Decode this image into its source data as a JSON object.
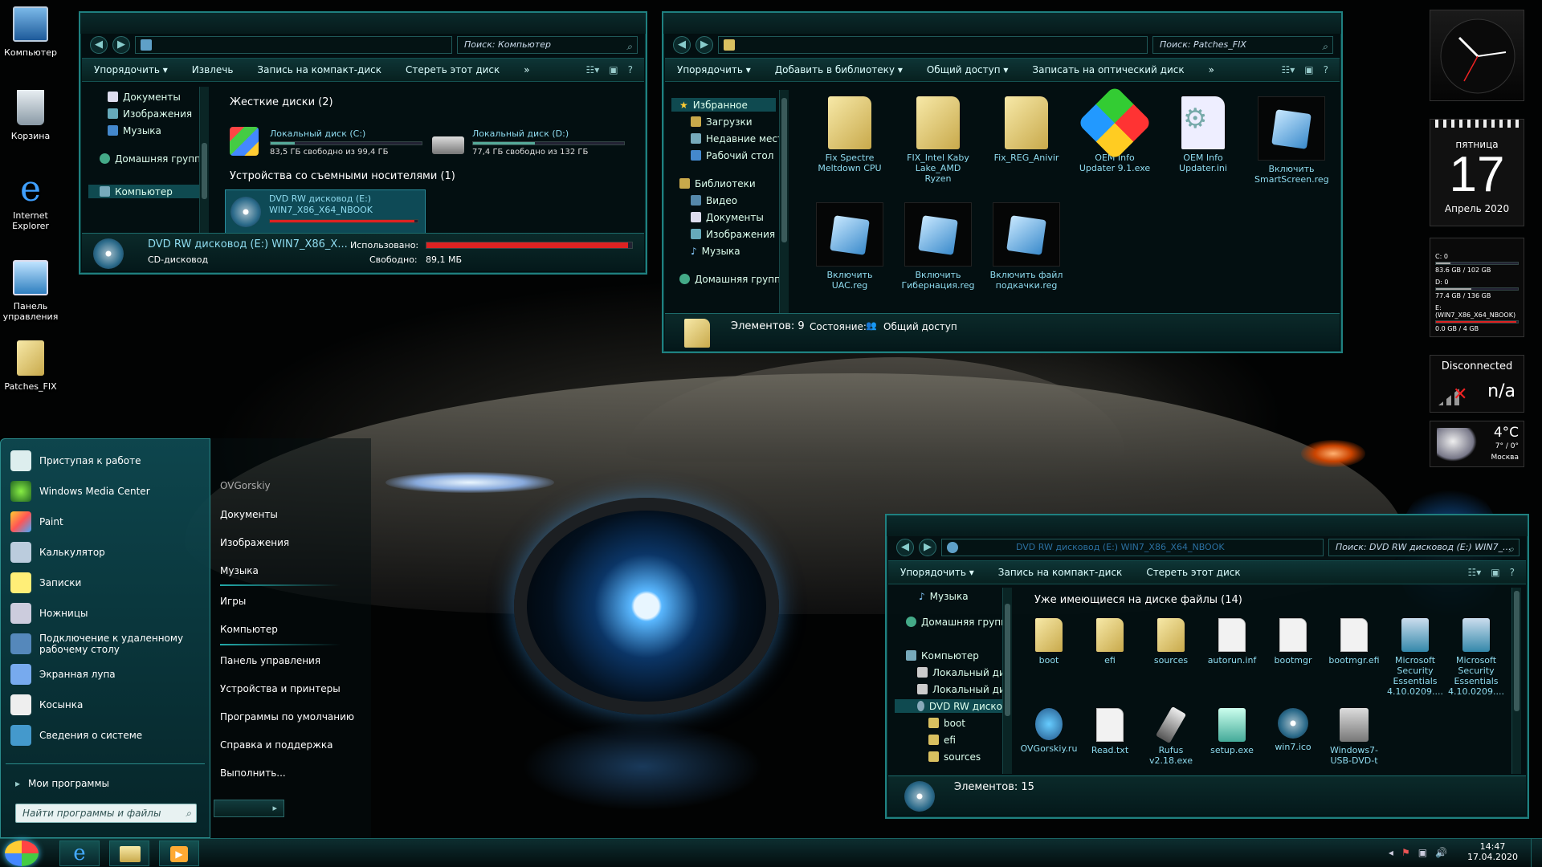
{
  "desktop_icons": [
    {
      "label": "Компьютер"
    },
    {
      "label": "Корзина"
    },
    {
      "label": "Internet Explorer"
    },
    {
      "label": "Панель управления"
    },
    {
      "label": "Patches_FIX"
    }
  ],
  "win1": {
    "search_placeholder": "Поиск: Компьютер",
    "toolbar": [
      "Упорядочить ▾",
      "Извлечь",
      "Запись на компакт-диск",
      "Стереть этот диск",
      "»"
    ],
    "nav": [
      "Документы",
      "Изображения",
      "Музыка",
      "Домашняя групп",
      "Компьютер"
    ],
    "hdd_group": "Жесткие диски (2)",
    "drive_c": {
      "name": "Локальный диск (C:)",
      "free": "83,5 ГБ свободно из 99,4 ГБ",
      "used": 0.16
    },
    "drive_d": {
      "name": "Локальный диск (D:)",
      "free": "77,4 ГБ свободно из 132 ГБ",
      "used": 0.41
    },
    "removable_group": "Устройства со съемными носителями (1)",
    "dvd": {
      "name": "DVD RW дисковод (E:)",
      "label": "WIN7_X86_X64_NBOOK",
      "used": 0.98
    },
    "status": {
      "title": "DVD RW дисковод (E:) WIN7_X86_X...",
      "type": "CD-дисковод",
      "used_label": "Использовано:",
      "free_label": "Свободно:",
      "free_value": "89,1 МБ",
      "used": 0.98
    }
  },
  "win2": {
    "search_placeholder": "Поиск: Patches_FIX",
    "toolbar": [
      "Упорядочить ▾",
      "Добавить в библиотеку ▾",
      "Общий доступ ▾",
      "Записать на оптический диск",
      "»"
    ],
    "nav": [
      "Избранное",
      "Загрузки",
      "Недавние мест",
      "Рабочий стол",
      "Библиотеки",
      "Видео",
      "Документы",
      "Изображения",
      "Музыка",
      "Домашняя групп"
    ],
    "files": [
      {
        "name": "Fix Spectre Meltdown CPU",
        "kind": "folder"
      },
      {
        "name": "FIX_Intel Kaby Lake_AMD Ryzen",
        "kind": "folder"
      },
      {
        "name": "Fix_REG_Anivir",
        "kind": "folder"
      },
      {
        "name": "OEM Info Updater 9.1.exe",
        "kind": "exe"
      },
      {
        "name": "OEM Info Updater.ini",
        "kind": "ini"
      },
      {
        "name": "Включить SmartScreen.reg",
        "kind": "reg"
      },
      {
        "name": "Включить UAC.reg",
        "kind": "reg"
      },
      {
        "name": "Включить Гибернация.reg",
        "kind": "reg"
      },
      {
        "name": "Включить файл подкачки.reg",
        "kind": "reg"
      }
    ],
    "status": {
      "items": "Элементов: 9",
      "state_label": "Состояние:",
      "state_value": "Общий доступ"
    }
  },
  "win3": {
    "address": "DVD RW дисковод (E:) WIN7_X86_X64_NBOOK",
    "search_placeholder": "Поиск: DVD RW дисковод (E:) WIN7_...",
    "toolbar": [
      "Упорядочить ▾",
      "Запись на компакт-диск",
      "Стереть этот диск"
    ],
    "nav": [
      "Музыка",
      "Домашняя групп",
      "Компьютер",
      "Локальный дис",
      "Локальный дис",
      "DVD RW диско",
      "boot",
      "efi",
      "sources"
    ],
    "group": "Уже имеющиеся на диске файлы (14)",
    "files": [
      {
        "name": "boot",
        "kind": "folder"
      },
      {
        "name": "efi",
        "kind": "folder"
      },
      {
        "name": "sources",
        "kind": "folder"
      },
      {
        "name": "autorun.inf",
        "kind": "ini"
      },
      {
        "name": "bootmgr",
        "kind": "doc"
      },
      {
        "name": "bootmgr.efi",
        "kind": "doc"
      },
      {
        "name": "Microsoft Security Essentials 4.10.0209....",
        "kind": "exe"
      },
      {
        "name": "Microsoft Security Essentials 4.10.0209....",
        "kind": "exe"
      },
      {
        "name": "OVGorskiy.ru",
        "kind": "exe"
      },
      {
        "name": "Read.txt",
        "kind": "doc"
      },
      {
        "name": "Rufus v2.18.exe",
        "kind": "exe"
      },
      {
        "name": "setup.exe",
        "kind": "exe"
      },
      {
        "name": "win7.ico",
        "kind": "exe"
      },
      {
        "name": "Windows7-USB-DVD-t",
        "kind": "exe"
      }
    ],
    "status": {
      "items": "Элементов: 15"
    }
  },
  "start_menu": {
    "left": [
      "Приступая к работе",
      "Windows Media Center",
      "Paint",
      "Калькулятор",
      "Записки",
      "Ножницы",
      "Подключение к удаленному рабочему столу",
      "Экранная лупа",
      "Косынка",
      "Сведения о системе"
    ],
    "all_programs": "Мои программы",
    "search_placeholder": "Найти программы и файлы",
    "right": [
      "OVGorskiy",
      "Документы",
      "Изображения",
      "Музыка",
      "Игры",
      "Компьютер",
      "Панель управления",
      "Устройства и принтеры",
      "Программы по умолчанию",
      "Справка и поддержка",
      "Выполнить..."
    ]
  },
  "gadgets": {
    "calendar": {
      "weekday": "пятница",
      "day": "17",
      "month": "Апрель 2020"
    },
    "drives": [
      {
        "label": "C: 0",
        "size": "83.6 GB / 102 GB",
        "used": 0.18
      },
      {
        "label": "D: 0",
        "size": "77.4 GB / 136 GB",
        "used": 0.43
      },
      {
        "label": "E: (WIN7_X86_X64_NBOOK)",
        "size": "0.0 GB / 4 GB",
        "used": 0.98
      }
    ],
    "network": {
      "status": "Disconnected",
      "value": "n/a"
    },
    "weather": {
      "temp": "4°C",
      "range": "7° / 0°",
      "city": "Москва"
    }
  },
  "taskbar": {
    "time": "14:47",
    "date": "17.04.2020"
  }
}
